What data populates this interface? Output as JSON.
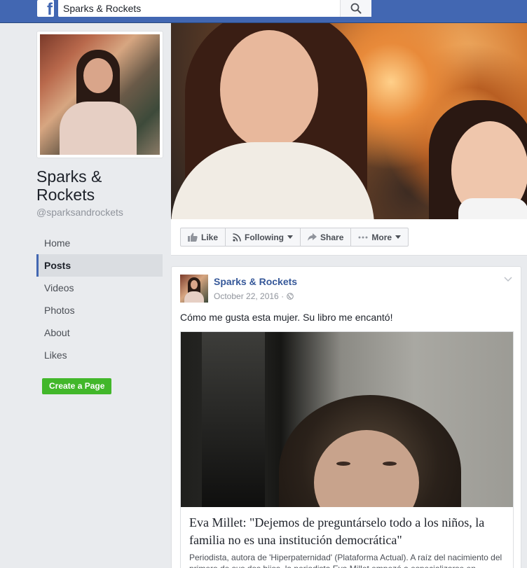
{
  "header": {
    "logo_letter": "f",
    "search_value": "Sparks & Rockets",
    "search_icon": "search-icon"
  },
  "page": {
    "name": "Sparks & Rockets",
    "handle": "@sparksandrockets"
  },
  "nav": {
    "items": [
      {
        "label": "Home"
      },
      {
        "label": "Posts",
        "active": true
      },
      {
        "label": "Videos"
      },
      {
        "label": "Photos"
      },
      {
        "label": "About"
      },
      {
        "label": "Likes"
      }
    ]
  },
  "create_page_label": "Create a Page",
  "actions": {
    "like": "Like",
    "following": "Following",
    "share": "Share",
    "more": "More"
  },
  "post": {
    "author": "Sparks & Rockets",
    "date": "October 22, 2016 ·",
    "text": "Cómo me gusta esta mujer. Su libro me encantó!",
    "link": {
      "title": "Eva Millet: \"Dejemos de preguntárselo todo a los niños, la familia no es una institución democrática\"",
      "description": "Periodista, autora de 'Hiperpaternidad' (Plataforma Actual). A raíz del nacimiento del primero de sus dos hijos, la periodista Eva Millet empezó a especializarse en..."
    }
  },
  "colors": {
    "brand_blue": "#4267b2",
    "link_blue": "#365899",
    "create_green": "#42b72a",
    "background": "#e9ebee"
  }
}
